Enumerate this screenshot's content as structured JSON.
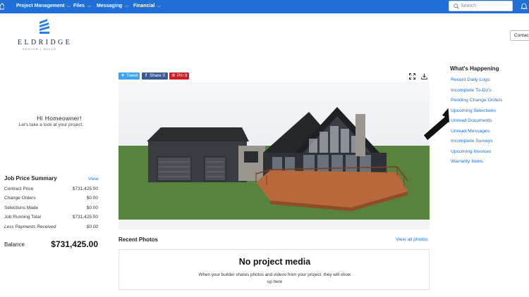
{
  "nav": {
    "items": [
      {
        "label": "Project Management"
      },
      {
        "label": "Files"
      },
      {
        "label": "Messaging"
      },
      {
        "label": "Financial"
      }
    ],
    "search_placeholder": "Search"
  },
  "contact_button": "Contact",
  "logo": {
    "word": "ELDRIDGE",
    "sub": "DESIGN | BUILD"
  },
  "greeting": {
    "title": "Hi Homeowner!",
    "subtitle": "Let's take a look at your project."
  },
  "job_price_summary": {
    "title": "Job Price Summary",
    "view_label": "View",
    "rows": [
      {
        "label": "Contract Price",
        "value": "$731,425.00"
      },
      {
        "label": "Change Orders",
        "value": "$0.00"
      },
      {
        "label": "Selections Made",
        "value": "$0.00"
      },
      {
        "label": "Job Running Total",
        "value": "$731,425.00"
      },
      {
        "label": "Less Payments Received",
        "value": "$0.00"
      }
    ],
    "balance_label": "Balance",
    "balance_value": "$731,425.00"
  },
  "share": {
    "tweet": "Tweet",
    "share": "Share",
    "share_count": "0",
    "pin": "Pin It"
  },
  "recent_photos": {
    "title": "Recent Photos",
    "view_all": "View all photos",
    "empty_title": "No project media",
    "empty_sub": "When your builder shares photos and videos from your project, they will show up here"
  },
  "whats_happening": {
    "title": "What's Happening",
    "links": [
      "Recent Daily Logs",
      "Incomplete To-Do's",
      "Pending Change Orders",
      "Upcoming Selections",
      "Unread Documents",
      "Unread Messages",
      "Incomplete Surveys",
      "Upcoming Invoices",
      "Warranty Items"
    ]
  },
  "colors": {
    "nav_blue": "#1f6fd6",
    "link_blue": "#1f6fd6",
    "tweet": "#3ea1ec",
    "facebook": "#3b5998",
    "pinterest": "#cb2027"
  }
}
